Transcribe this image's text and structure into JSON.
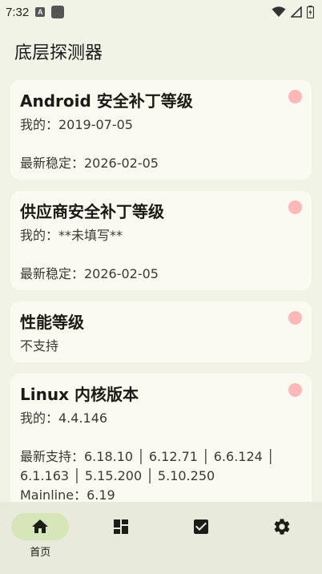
{
  "status_bar": {
    "time": "7:32",
    "notification_badge": "A"
  },
  "page": {
    "title": "底层探测器"
  },
  "cards": [
    {
      "title": "Android 安全补丁等级",
      "mine": "我的：2019-07-05",
      "latest": "最新稳定：2026-02-05"
    },
    {
      "title": "供应商安全补丁等级",
      "mine": "我的：**未填写**",
      "latest": "最新稳定：2026-02-05"
    },
    {
      "title": "性能等级",
      "mine": "不支持"
    },
    {
      "title": "Linux 内核版本",
      "mine": "我的：4.4.146",
      "supported_line1": "最新支持：6.18.10 │ 6.12.71 │ 6.6.124 │",
      "supported_line2": "6.1.163 │ 5.15.200 │ 5.10.250",
      "mainline": "Mainline：6.19"
    }
  ],
  "nav": {
    "items": [
      {
        "label": "首页",
        "icon": "home-icon",
        "active": true
      },
      {
        "label": "",
        "icon": "dashboard-icon",
        "active": false
      },
      {
        "label": "",
        "icon": "checkbox-icon",
        "active": false
      },
      {
        "label": "",
        "icon": "gear-icon",
        "active": false
      }
    ]
  },
  "colors": {
    "background": "#f2f3e7",
    "card": "#fafaf0",
    "status_dot": "#ffb8b8",
    "nav_bar": "#e8eadb",
    "nav_active_pill": "#d6e6b8"
  }
}
